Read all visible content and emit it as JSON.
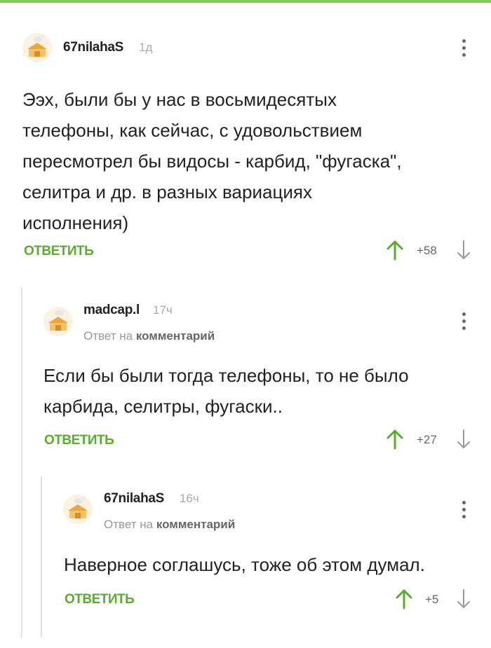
{
  "comments": [
    {
      "author": "67nilahaS",
      "time": "1д",
      "reply_label": "",
      "reply_target": "",
      "text_lines": [
        "Ээх, были бы у нас в восьмидесятых",
        "телефоны, как сейчас, с удовольствием",
        "пересмотрел бы видосы - карбид, \"фугаска\",",
        "селитра и др. в разных вариациях",
        "исполнения)"
      ],
      "reply_button": "ОТВЕТИТЬ",
      "score": "+58"
    },
    {
      "author": "madcap.l",
      "time": "17ч",
      "reply_label": "Ответ на",
      "reply_target": "комментарий",
      "text_lines": [
        "Если бы были тогда телефоны, то не было",
        "карбида, селитры, фугаски.."
      ],
      "reply_button": "ОТВЕТИТЬ",
      "score": "+27"
    },
    {
      "author": "67nilahaS",
      "time": "16ч",
      "reply_label": "Ответ на",
      "reply_target": "комментарий",
      "text_lines": [
        "Наверное соглашусь, тоже об этом думал."
      ],
      "reply_button": "ОТВЕТИТЬ",
      "score": "+5"
    }
  ],
  "icons": {
    "menu": "more-vertical-icon",
    "upvote": "arrow-up-icon",
    "downvote": "arrow-down-icon",
    "avatar": "default-avatar-icon"
  },
  "colors": {
    "accent": "#5aac2e",
    "upvote": "#5aac2e",
    "downvote": "#999999",
    "thread_line": "#e2e2e2"
  }
}
